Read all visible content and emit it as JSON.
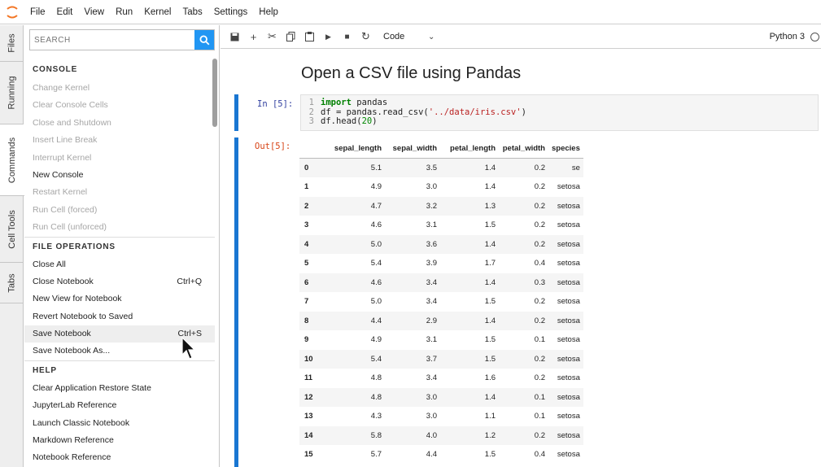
{
  "menubar": {
    "items": [
      "File",
      "Edit",
      "View",
      "Run",
      "Kernel",
      "Tabs",
      "Settings",
      "Help"
    ]
  },
  "left_tabs": [
    "Files",
    "Running",
    "Commands",
    "Cell Tools",
    "Tabs"
  ],
  "commands_panel": {
    "search_placeholder": "SEARCH",
    "sections": [
      {
        "header": "CONSOLE",
        "items": [
          {
            "label": "Change Kernel",
            "shortcut": "",
            "disabled": true
          },
          {
            "label": "Clear Console Cells",
            "shortcut": "",
            "disabled": true
          },
          {
            "label": "Close and Shutdown",
            "shortcut": "",
            "disabled": true
          },
          {
            "label": "Insert Line Break",
            "shortcut": "",
            "disabled": true
          },
          {
            "label": "Interrupt Kernel",
            "shortcut": "",
            "disabled": true
          },
          {
            "label": "New Console",
            "shortcut": "",
            "disabled": false
          },
          {
            "label": "Restart Kernel",
            "shortcut": "",
            "disabled": true
          },
          {
            "label": "Run Cell (forced)",
            "shortcut": "",
            "disabled": true
          },
          {
            "label": "Run Cell (unforced)",
            "shortcut": "",
            "disabled": true
          }
        ]
      },
      {
        "header": "FILE OPERATIONS",
        "items": [
          {
            "label": "Close All",
            "shortcut": "",
            "disabled": false
          },
          {
            "label": "Close Notebook",
            "shortcut": "Ctrl+Q",
            "disabled": false
          },
          {
            "label": "New View for Notebook",
            "shortcut": "",
            "disabled": false
          },
          {
            "label": "Revert Notebook to Saved",
            "shortcut": "",
            "disabled": false
          },
          {
            "label": "Save Notebook",
            "shortcut": "Ctrl+S",
            "disabled": false,
            "hover": true
          },
          {
            "label": "Save Notebook As...",
            "shortcut": "",
            "disabled": false
          }
        ]
      },
      {
        "header": "HELP",
        "items": [
          {
            "label": "Clear Application Restore State",
            "shortcut": "",
            "disabled": false
          },
          {
            "label": "JupyterLab Reference",
            "shortcut": "",
            "disabled": false
          },
          {
            "label": "Launch Classic Notebook",
            "shortcut": "",
            "disabled": false
          },
          {
            "label": "Markdown Reference",
            "shortcut": "",
            "disabled": false
          },
          {
            "label": "Notebook Reference",
            "shortcut": "",
            "disabled": false
          }
        ]
      }
    ]
  },
  "notebook_toolbar": {
    "cell_type": "Code",
    "kernel": "Python 3"
  },
  "notebook": {
    "markdown_title": "Open a CSV file using Pandas",
    "in_prompt": "In [5]:",
    "out_prompt": "Out[5]:",
    "code_lines": [
      {
        "no": "1",
        "kw": "import",
        "rest": " pandas"
      },
      {
        "no": "2",
        "pre": "df = pandas.read_csv(",
        "str": "'../data/iris.csv'",
        "post": ")"
      },
      {
        "no": "3",
        "pre": "df.head(",
        "num": "20",
        "post": ")"
      }
    ],
    "table": {
      "columns": [
        "",
        "sepal_length",
        "sepal_width",
        "petal_length",
        "petal_width",
        "species"
      ],
      "rows": [
        [
          "0",
          "5.1",
          "3.5",
          "1.4",
          "0.2",
          "se"
        ],
        [
          "1",
          "4.9",
          "3.0",
          "1.4",
          "0.2",
          "setosa"
        ],
        [
          "2",
          "4.7",
          "3.2",
          "1.3",
          "0.2",
          "setosa"
        ],
        [
          "3",
          "4.6",
          "3.1",
          "1.5",
          "0.2",
          "setosa"
        ],
        [
          "4",
          "5.0",
          "3.6",
          "1.4",
          "0.2",
          "setosa"
        ],
        [
          "5",
          "5.4",
          "3.9",
          "1.7",
          "0.4",
          "setosa"
        ],
        [
          "6",
          "4.6",
          "3.4",
          "1.4",
          "0.3",
          "setosa"
        ],
        [
          "7",
          "5.0",
          "3.4",
          "1.5",
          "0.2",
          "setosa"
        ],
        [
          "8",
          "4.4",
          "2.9",
          "1.4",
          "0.2",
          "setosa"
        ],
        [
          "9",
          "4.9",
          "3.1",
          "1.5",
          "0.1",
          "setosa"
        ],
        [
          "10",
          "5.4",
          "3.7",
          "1.5",
          "0.2",
          "setosa"
        ],
        [
          "11",
          "4.8",
          "3.4",
          "1.6",
          "0.2",
          "setosa"
        ],
        [
          "12",
          "4.8",
          "3.0",
          "1.4",
          "0.1",
          "setosa"
        ],
        [
          "13",
          "4.3",
          "3.0",
          "1.1",
          "0.1",
          "setosa"
        ],
        [
          "14",
          "5.8",
          "4.0",
          "1.2",
          "0.2",
          "setosa"
        ],
        [
          "15",
          "5.7",
          "4.4",
          "1.5",
          "0.4",
          "setosa"
        ]
      ]
    }
  },
  "colors": {
    "accent": "#2196f3",
    "collapser": "#1976d2",
    "in_prompt": "#303f9f",
    "out_prompt": "#d84315"
  }
}
